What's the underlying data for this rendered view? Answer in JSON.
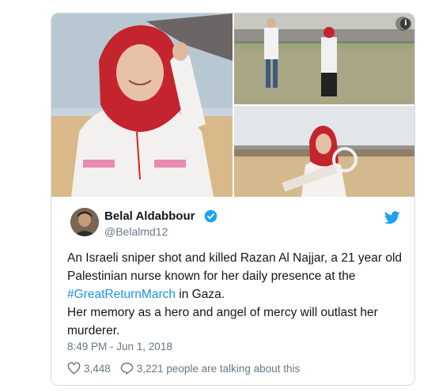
{
  "author": {
    "name": "Belal Aldabbour",
    "handle": "@Belalmd12"
  },
  "tweet": {
    "line1": "An Israeli sniper shot and killed Razan Al Najjar, a 21 year old Palestinian nurse known for her daily presence at the ",
    "hashtag": "#GreatReturnMarch",
    "line1_end": " in Gaza.",
    "line2": "Her memory as a hero and angel of mercy will outlast her murderer."
  },
  "timestamp": "8:49 PM - Jun 1, 2018",
  "actions": {
    "likes": "3,448",
    "talking": "3,221 people are talking about this"
  },
  "icons": {
    "info": "i",
    "verified": "verified-badge-icon",
    "bird": "twitter-bird-icon",
    "heart": "heart-icon",
    "comment": "speech-bubble-icon"
  },
  "colors": {
    "link": "#1b95e0",
    "verified": "#1da1f2",
    "text": "#14171a",
    "muted": "#657786"
  }
}
